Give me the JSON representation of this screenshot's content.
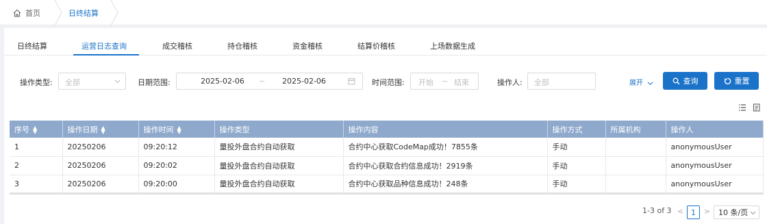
{
  "breadcrumb": {
    "home": "首页",
    "current": "日终结算"
  },
  "tabs": [
    {
      "label": "日终结算",
      "active": false
    },
    {
      "label": "运营日志查询",
      "active": true
    },
    {
      "label": "成交稽核",
      "active": false
    },
    {
      "label": "持仓稽核",
      "active": false
    },
    {
      "label": "资金稽核",
      "active": false
    },
    {
      "label": "结算价稽核",
      "active": false
    },
    {
      "label": "上场数据生成",
      "active": false
    }
  ],
  "filters": {
    "op_type": {
      "label": "操作类型:",
      "value": "全部"
    },
    "date_range": {
      "label": "日期范围:",
      "start": "2025-02-06",
      "sep": "~",
      "end": "2025-02-06"
    },
    "time_range": {
      "label": "时间范围:",
      "start_placeholder": "开始",
      "sep": "~",
      "end_placeholder": "结束"
    },
    "operator": {
      "label": "操作人:",
      "placeholder": "全部"
    },
    "expand": "展开",
    "search": "查询",
    "reset": "重置"
  },
  "table": {
    "columns": [
      "序号",
      "操作日期",
      "操作时间",
      "操作类型",
      "操作内容",
      "操作方式",
      "所属机构",
      "操作人"
    ],
    "rows": [
      [
        "1",
        "20250206",
        "09:20:12",
        "量投外盘合约自动获取",
        "合约中心获取CodeMap成功！7855条",
        "手动",
        "",
        "anonymousUser"
      ],
      [
        "2",
        "20250206",
        "09:20:02",
        "量投外盘合约自动获取",
        "合约中心获取合约信息成功！2919条",
        "手动",
        "",
        "anonymousUser"
      ],
      [
        "3",
        "20250206",
        "09:20:00",
        "量投外盘合约自动获取",
        "合约中心获取品种信息成功！248条",
        "手动",
        "",
        "anonymousUser"
      ]
    ]
  },
  "pagination": {
    "summary": "1-3 of 3",
    "current_page": "1",
    "page_size": "10 条/页"
  },
  "colors": {
    "accent": "#1a73c9",
    "header_bg": "#8fa9cc"
  }
}
